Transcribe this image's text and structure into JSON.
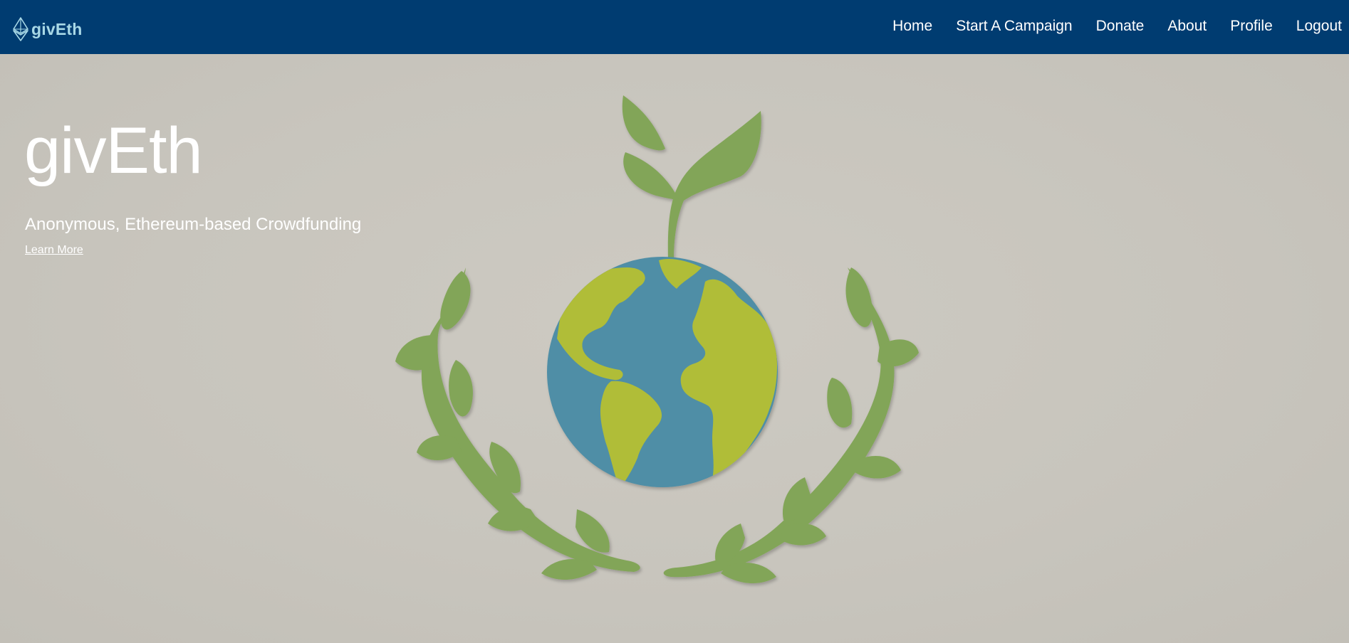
{
  "navbar": {
    "brand_text": "givEth",
    "links": [
      {
        "label": "Home"
      },
      {
        "label": "Start A Campaign"
      },
      {
        "label": "Donate"
      },
      {
        "label": "About"
      },
      {
        "label": "Profile"
      },
      {
        "label": "Logout"
      }
    ],
    "background_color": "#003c71",
    "brand_icon": "ethereum-diamond-icon"
  },
  "hero": {
    "title": "givEth",
    "subtitle": "Anonymous, Ethereum-based Crowdfunding",
    "learn_more_label": "Learn More",
    "image": "paper-cut globe with sprout and laurel wreath",
    "colors": {
      "background": "#c8c5bd",
      "ocean": "#4f8ea6",
      "land": "#b0bd37",
      "leaves": "#82a558"
    }
  }
}
